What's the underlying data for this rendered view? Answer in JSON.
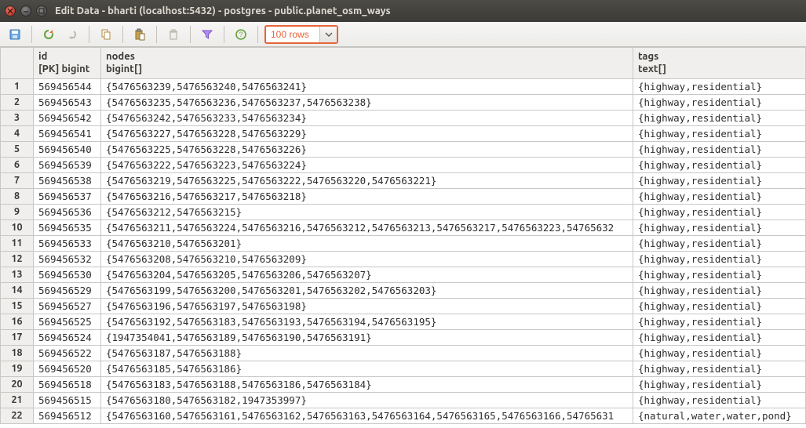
{
  "window": {
    "title": "Edit Data - bharti (localhost:5432) - postgres - public.planet_osm_ways"
  },
  "toolbar": {
    "rows_value": "100 rows"
  },
  "columns": [
    {
      "name": "id",
      "type": "[PK] bigint"
    },
    {
      "name": "nodes",
      "type": "bigint[]"
    },
    {
      "name": "tags",
      "type": "text[]"
    }
  ],
  "rows": [
    {
      "n": "1",
      "id": "569456544",
      "nodes": "{5476563239,5476563240,5476563241}",
      "tags": "{highway,residential}"
    },
    {
      "n": "2",
      "id": "569456543",
      "nodes": "{5476563235,5476563236,5476563237,5476563238}",
      "tags": "{highway,residential}"
    },
    {
      "n": "3",
      "id": "569456542",
      "nodes": "{5476563242,5476563233,5476563234}",
      "tags": "{highway,residential}"
    },
    {
      "n": "4",
      "id": "569456541",
      "nodes": "{5476563227,5476563228,5476563229}",
      "tags": "{highway,residential}"
    },
    {
      "n": "5",
      "id": "569456540",
      "nodes": "{5476563225,5476563228,5476563226}",
      "tags": "{highway,residential}"
    },
    {
      "n": "6",
      "id": "569456539",
      "nodes": "{5476563222,5476563223,5476563224}",
      "tags": "{highway,residential}"
    },
    {
      "n": "7",
      "id": "569456538",
      "nodes": "{5476563219,5476563225,5476563222,5476563220,5476563221}",
      "tags": "{highway,residential}"
    },
    {
      "n": "8",
      "id": "569456537",
      "nodes": "{5476563216,5476563217,5476563218}",
      "tags": "{highway,residential}"
    },
    {
      "n": "9",
      "id": "569456536",
      "nodes": "{5476563212,5476563215}",
      "tags": "{highway,residential}"
    },
    {
      "n": "10",
      "id": "569456535",
      "nodes": "{5476563211,5476563224,5476563216,5476563212,5476563213,5476563217,5476563223,54765632",
      "tags": "{highway,residential}"
    },
    {
      "n": "11",
      "id": "569456533",
      "nodes": "{5476563210,5476563201}",
      "tags": "{highway,residential}"
    },
    {
      "n": "12",
      "id": "569456532",
      "nodes": "{5476563208,5476563210,5476563209}",
      "tags": "{highway,residential}"
    },
    {
      "n": "13",
      "id": "569456530",
      "nodes": "{5476563204,5476563205,5476563206,5476563207}",
      "tags": "{highway,residential}"
    },
    {
      "n": "14",
      "id": "569456529",
      "nodes": "{5476563199,5476563200,5476563201,5476563202,5476563203}",
      "tags": "{highway,residential}"
    },
    {
      "n": "15",
      "id": "569456527",
      "nodes": "{5476563196,5476563197,5476563198}",
      "tags": "{highway,residential}"
    },
    {
      "n": "16",
      "id": "569456525",
      "nodes": "{5476563192,5476563183,5476563193,5476563194,5476563195}",
      "tags": "{highway,residential}"
    },
    {
      "n": "17",
      "id": "569456524",
      "nodes": "{1947354041,5476563189,5476563190,5476563191}",
      "tags": "{highway,residential}"
    },
    {
      "n": "18",
      "id": "569456522",
      "nodes": "{5476563187,5476563188}",
      "tags": "{highway,residential}"
    },
    {
      "n": "19",
      "id": "569456520",
      "nodes": "{5476563185,5476563186}",
      "tags": "{highway,residential}"
    },
    {
      "n": "20",
      "id": "569456518",
      "nodes": "{5476563183,5476563188,5476563186,5476563184}",
      "tags": "{highway,residential}"
    },
    {
      "n": "21",
      "id": "569456515",
      "nodes": "{5476563180,5476563182,1947353997}",
      "tags": "{highway,residential}"
    },
    {
      "n": "22",
      "id": "569456512",
      "nodes": "{5476563160,5476563161,5476563162,5476563163,5476563164,5476563165,5476563166,54765631",
      "tags": "{natural,water,water,pond}"
    }
  ]
}
